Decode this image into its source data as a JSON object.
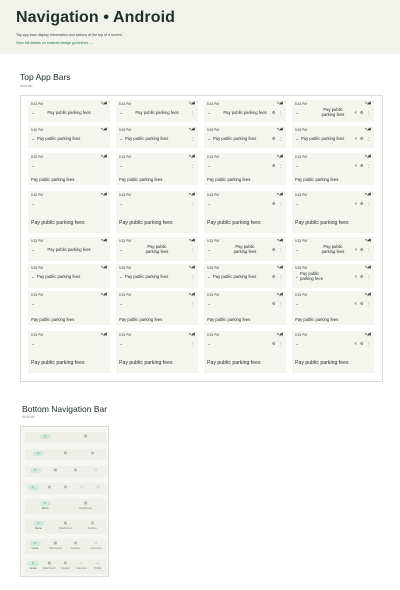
{
  "header": {
    "title": "Navigation • Android",
    "description": "Top app bars display information and actions at the top of a screen.",
    "link_label": "View full details on material design guidelines →"
  },
  "top_app_bars": {
    "title": "Top App Bars",
    "platform": "Android",
    "status_time_a": "5:32 PM",
    "status_time_b": "5:33 PM",
    "status_icons": "▾◢▮",
    "bar_title": "Pay public parking fees",
    "icons": {
      "back": "arrow-back",
      "more": "more-vert",
      "share": "share",
      "settings": "settings"
    }
  },
  "bottom_navigation": {
    "title": "Bottom Navigation Bar",
    "platform": "Android",
    "labels": [
      "Home",
      "Dashboard",
      "Explore",
      "Favorites",
      "Profile"
    ]
  },
  "colors": {
    "accent": "#2c6e49",
    "hero_bg": "#f1f2ec",
    "bar_bg": "#f5f5f0",
    "pill_active": "#d3e8dc"
  }
}
